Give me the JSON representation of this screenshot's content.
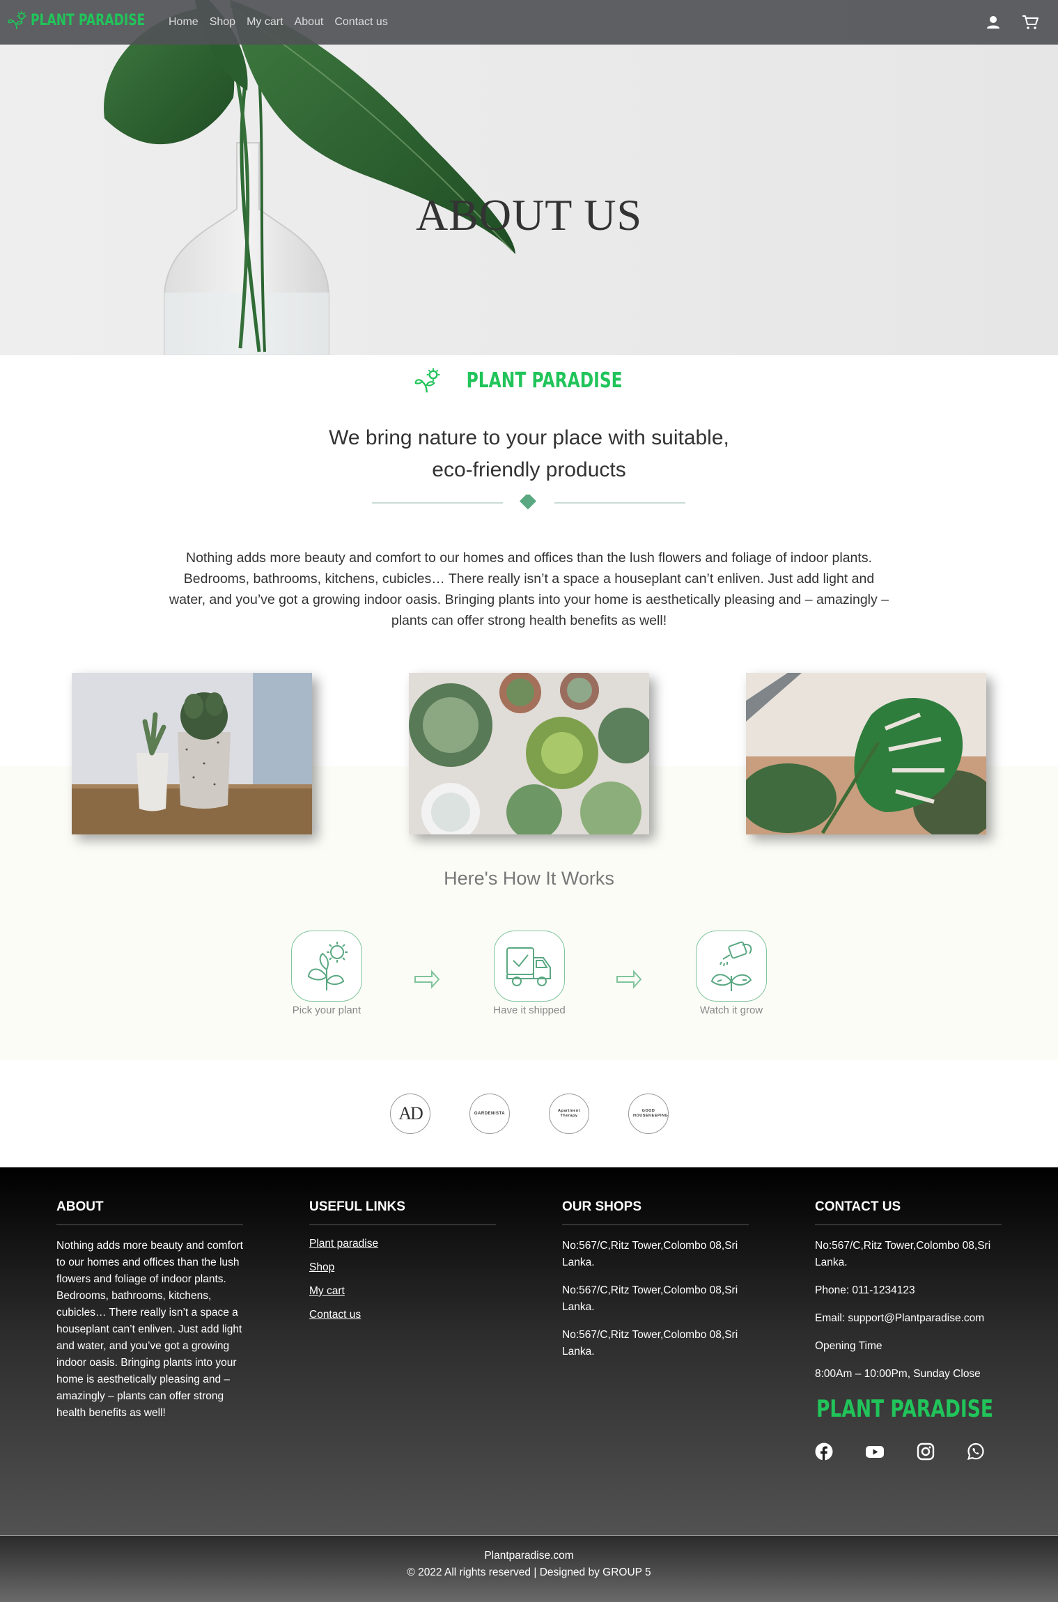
{
  "nav": {
    "brand": "PLANT PARADISE",
    "links": [
      "Home",
      "Shop",
      "My cart",
      "About",
      "Contact us"
    ],
    "icons": [
      "user-icon",
      "cart-icon"
    ]
  },
  "hero": {
    "title": "ABOUT US"
  },
  "intro": {
    "brand": "PLANT PARADISE",
    "tagline_line1": "We bring nature to your place with suitable,",
    "tagline_line2": "eco-friendly products",
    "text": "Nothing adds more beauty and comfort to our homes and offices than the lush flowers and foliage of indoor plants. Bedrooms, bathrooms, kitchens, cubicles… There really isn’t a space a houseplant can’t enliven. Just add light and water, and you’ve got a growing indoor oasis. Bringing plants into your home is aesthetically pleasing and – amazingly – plants can offer strong health benefits as well!"
  },
  "how": {
    "title": "Here's How It Works",
    "steps": [
      "Pick your plant",
      "Have it shipped",
      "Watch it grow"
    ]
  },
  "partners": [
    "AD",
    "GARDENISTA",
    "Apartment Therapy",
    "GOOD HOUSEKEEPING"
  ],
  "footer": {
    "about": {
      "heading": "ABOUT",
      "text": "Nothing adds more beauty and comfort to our homes and offices than the lush flowers and foliage of indoor plants. Bedrooms, bathrooms, kitchens, cubicles… There really isn’t a space a houseplant can’t enliven. Just add light and water, and you’ve got a growing indoor oasis. Bringing plants into your home is aesthetically pleasing and – amazingly – plants can offer strong health benefits as well!"
    },
    "links": {
      "heading": "USEFUL LINKS",
      "items": [
        "Plant paradise",
        "Shop",
        "My cart",
        "Contact us"
      ]
    },
    "shops": {
      "heading": "OUR SHOPS",
      "items": [
        "No:567/C,Ritz Tower,Colombo 08,Sri Lanka.",
        "No:567/C,Ritz Tower,Colombo 08,Sri Lanka.",
        "No:567/C,Ritz Tower,Colombo 08,Sri Lanka."
      ]
    },
    "contact": {
      "heading": "CONTACT US",
      "address": "No:567/C,Ritz Tower,Colombo 08,Sri Lanka.",
      "phone": "Phone: 011-1234123",
      "email": "Email: support@Plantparadise.com",
      "hours_label": "Opening Time",
      "hours": "8:00Am – 10:00Pm, Sunday Close",
      "brand": "PLANT PARADISE",
      "socials": [
        "facebook-icon",
        "youtube-icon",
        "instagram-icon",
        "whatsapp-icon"
      ]
    },
    "site": "Plantparadise.com",
    "copyright": "© 2022 All rights reserved | Designed by GROUP 5"
  },
  "colors": {
    "brand_green": "#21c45a",
    "accent_green": "#5aa882",
    "footer_dark": "#000000"
  }
}
